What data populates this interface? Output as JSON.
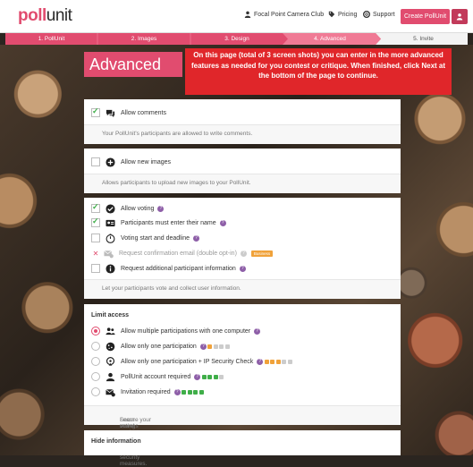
{
  "header": {
    "logo_a": "poll",
    "logo_b": "unit",
    "nav": [
      {
        "label": "Focal Point Camera Club",
        "icon": "user-icon"
      },
      {
        "label": "Pricing",
        "icon": "tag-icon"
      },
      {
        "label": "Support",
        "icon": "lifebuoy-icon"
      }
    ],
    "create_label": "Create PollUnit"
  },
  "steps": [
    {
      "label": "1. PollUnit",
      "state": "done"
    },
    {
      "label": "2. Images",
      "state": "done"
    },
    {
      "label": "3. Design",
      "state": "done"
    },
    {
      "label": "4. Advanced",
      "state": "active"
    },
    {
      "label": "5. Invite",
      "state": "todo"
    }
  ],
  "colors": {
    "brand": "#e14c6f",
    "brand_light": "#f07a95",
    "callout": "#e0262a",
    "check": "#3fae49",
    "help": "#8e5fa8",
    "business": "#f0a23a"
  },
  "page_title": "Advanced",
  "callout_text": "On this page (total of 3 screen shots) you can enter in the more advanced features as needed for you contest or critique. When finished, click Next at the bottom of the page to continue.",
  "comments": {
    "label": "Allow comments",
    "checked": true,
    "description": "Your PollUnit's participants are allowed to write comments."
  },
  "images": {
    "label": "Allow new images",
    "checked": false,
    "description": "Allows participants to upload new images to your PollUnit."
  },
  "voting": {
    "items": [
      {
        "label": "Allow voting",
        "checked": true,
        "icon": "check-circle-icon"
      },
      {
        "label": "Participants must enter their name",
        "checked": true,
        "icon": "id-card-icon"
      },
      {
        "label": "Voting start and deadline",
        "checked": false,
        "icon": "stopwatch-icon"
      },
      {
        "label": "Request confirmation email (double opt-in)",
        "checked": false,
        "icon": "email-check-icon",
        "badge": "Business",
        "disabled": true
      },
      {
        "label": "Request additional participant information",
        "checked": false,
        "icon": "info-icon"
      }
    ],
    "description": "Let your participants vote and collect user information."
  },
  "limit": {
    "title": "Limit access",
    "options": [
      {
        "label": "Allow multiple participations with one computer",
        "selected": true,
        "icon": "users-icon",
        "locks": 0
      },
      {
        "label": "Allow only one participation",
        "selected": false,
        "icon": "cookie-icon",
        "locks": 4
      },
      {
        "label": "Allow only one participation + IP Security Check",
        "selected": false,
        "icon": "shield-icon",
        "locks": 5
      },
      {
        "label": "PollUnit account required",
        "selected": false,
        "icon": "user-icon",
        "locks": 4
      },
      {
        "label": "Invitation required",
        "selected": false,
        "icon": "envelope-icon",
        "locks": 4
      }
    ],
    "description": "Secure your votings against multiple participations by various security measures.",
    "learn_more": "Learn more!"
  },
  "hide": {
    "title": "Hide information"
  }
}
